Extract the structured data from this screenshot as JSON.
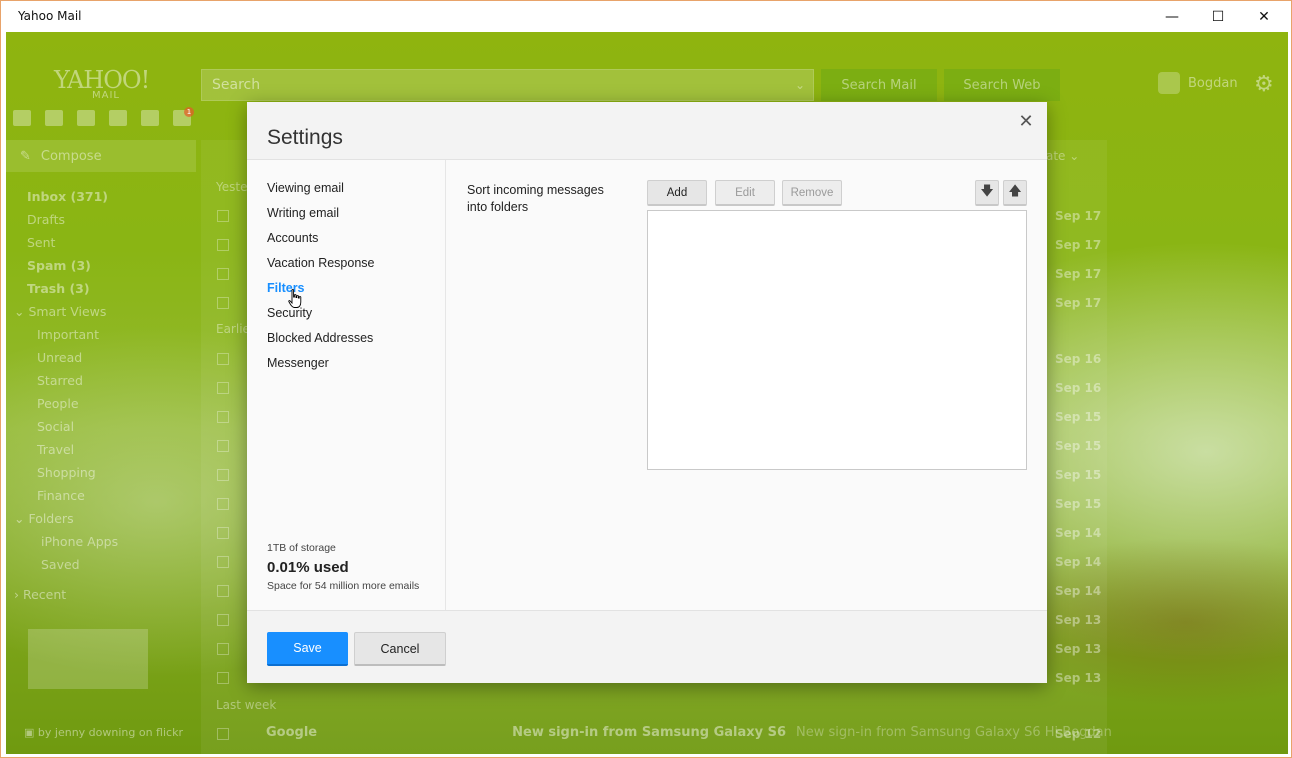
{
  "window": {
    "title": "Yahoo Mail",
    "minimize_glyph": "—",
    "maximize_glyph": "☐",
    "close_glyph": "✕"
  },
  "app": {
    "logo": "YAHOO!",
    "logo_sub": "MAIL",
    "search_placeholder": "Search",
    "search_mail": "Search Mail",
    "search_web": "Search Web",
    "user_name": "Bogdan",
    "notification_count": "1",
    "compose_label": "Compose",
    "folders": [
      {
        "label": "Inbox (371)",
        "bold": true
      },
      {
        "label": "Drafts"
      },
      {
        "label": "Sent"
      },
      {
        "label": "Spam (3)",
        "bold": true
      },
      {
        "label": "Trash (3)",
        "bold": true
      },
      {
        "label": "Smart Views",
        "header": true
      },
      {
        "label": "Important",
        "sub": true
      },
      {
        "label": "Unread",
        "sub": true
      },
      {
        "label": "Starred",
        "sub": true
      },
      {
        "label": "People",
        "sub": true
      },
      {
        "label": "Social",
        "sub": true
      },
      {
        "label": "Travel",
        "sub": true
      },
      {
        "label": "Shopping",
        "sub": true
      },
      {
        "label": "Finance",
        "sub": true
      },
      {
        "label": "Folders",
        "header": true
      },
      {
        "label": "iPhone Apps",
        "sub2": true
      },
      {
        "label": "Saved",
        "sub2": true
      },
      {
        "label": "Recent",
        "header": true
      }
    ],
    "credit": "by jenny downing on flickr",
    "sort_label": "ate",
    "sections": [
      "Yeste",
      "Earlie",
      "Last week"
    ],
    "dates": [
      "Sep 17",
      "Sep 17",
      "Sep 17",
      "Sep 17",
      "Sep 16",
      "Sep 16",
      "Sep 15",
      "Sep 15",
      "Sep 15",
      "Sep 15",
      "Sep 14",
      "Sep 14",
      "Sep 14",
      "Sep 13",
      "Sep 13",
      "Sep 13",
      "Sep 12"
    ],
    "last_mail": {
      "sender": "Google",
      "subject": "New sign-in from Samsung Galaxy S6",
      "snippet": "New sign-in from Samsung Galaxy S6 Hi Bogdan"
    }
  },
  "dialog": {
    "title": "Settings",
    "close_glyph": "✕",
    "nav": [
      {
        "label": "Viewing email",
        "active": false
      },
      {
        "label": "Writing email",
        "active": false
      },
      {
        "label": "Accounts",
        "active": false
      },
      {
        "label": "Vacation Response",
        "active": false
      },
      {
        "label": "Filters",
        "active": true
      },
      {
        "label": "Security",
        "active": false
      },
      {
        "label": "Blocked Addresses",
        "active": false
      },
      {
        "label": "Messenger",
        "active": false
      }
    ],
    "storage": {
      "total": "1TB of storage",
      "used": "0.01% used",
      "space": "Space for 54 million more emails"
    },
    "filters": {
      "label": "Sort incoming messages into folders",
      "add": "Add",
      "edit": "Edit",
      "remove": "Remove",
      "down_glyph": "🡇",
      "up_glyph": "🡅"
    },
    "footer": {
      "save": "Save",
      "cancel": "Cancel"
    }
  }
}
